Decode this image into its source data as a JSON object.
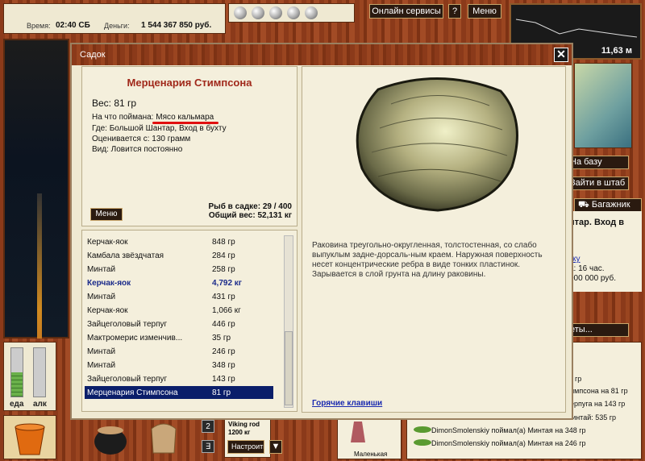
{
  "top": {
    "time_label": "Время:",
    "time_value": "02:40 СБ",
    "money_label": "Деньги:",
    "money_value": "1 544 367 850 руб.",
    "online_services": "Онлайн сервисы",
    "help": "?",
    "menu": "Меню",
    "depth": "11,63 м"
  },
  "meters": {
    "food": "еда",
    "alc": "алк",
    "food_level": 0.5,
    "alc_level": 0.0
  },
  "right_panel": {
    "to_base": "На базу",
    "to_hq": "Зайти в штаб",
    "trunk": "Багажник",
    "location_title": "нтар. Вход в",
    "link": "ку",
    "info_hours": "а: 16 час.",
    "info_money": "000 000 руб.",
    "more": "еты..."
  },
  "log": {
    "partial_1": "гр",
    "partial_2": "тимпсона на 81 гр",
    "partial_3": "терпуга на 143 гр",
    "partial_4": "минтай: 535 гр",
    "line_1": "DimonSmolenskiy поймал(а) Минтая на 348 гр",
    "line_2": "DimonSmolenskiy поймал(а) Минтая на 246 гр"
  },
  "bottom": {
    "count": "2",
    "rod_name": "Viking rod",
    "rod_weight": "1200 кг",
    "setup": "Настроить",
    "lure_label": "Маленькая"
  },
  "modal": {
    "title": "Садок",
    "close": "✕",
    "fish_name": "Мерценария Стимпсона",
    "weight": "Вес: 81 гр",
    "caught_on_label": "На что поймана:",
    "caught_on_value": "Мясо кальмара",
    "where": "Где: Большой Шантар, Вход в бухту",
    "valued_from": "Оценивается с: 130 грамм",
    "kind": "Вид: Ловится постоянно",
    "menu": "Меню",
    "fish_count": "Рыб в садке: 29 / 400",
    "total_weight": "Общий вес: 52,131 кг",
    "description": "Раковина треугольно-округленная, толстостенная, со слабо выпуклым задне-дорсаль-ным краем. Наружная поверхность несет концентрические ребра в виде тонких пластинок. Зарывается в слой грунта на длину раковины.",
    "hotkeys": "Горячие клавиши",
    "fish_list": [
      {
        "name": "Керчак-яок",
        "weight": "848 гр"
      },
      {
        "name": "Камбала звёздчатая",
        "weight": "284 гр"
      },
      {
        "name": "Минтай",
        "weight": "258 гр"
      },
      {
        "name": "Керчак-яок",
        "weight": "4,792 кг",
        "style": "bold"
      },
      {
        "name": "Минтай",
        "weight": "431 гр"
      },
      {
        "name": "Керчак-яок",
        "weight": "1,066 кг"
      },
      {
        "name": "Зайцеголовый терпуг",
        "weight": "446 гр"
      },
      {
        "name": "Мактромерис изменчив...",
        "weight": "35 гр"
      },
      {
        "name": "Минтай",
        "weight": "246 гр"
      },
      {
        "name": "Минтай",
        "weight": "348 гр"
      },
      {
        "name": "Зайцеголовый терпуг",
        "weight": "143 гр"
      },
      {
        "name": "Мерценария Стимпсона",
        "weight": "81 гр",
        "style": "selected"
      }
    ]
  }
}
